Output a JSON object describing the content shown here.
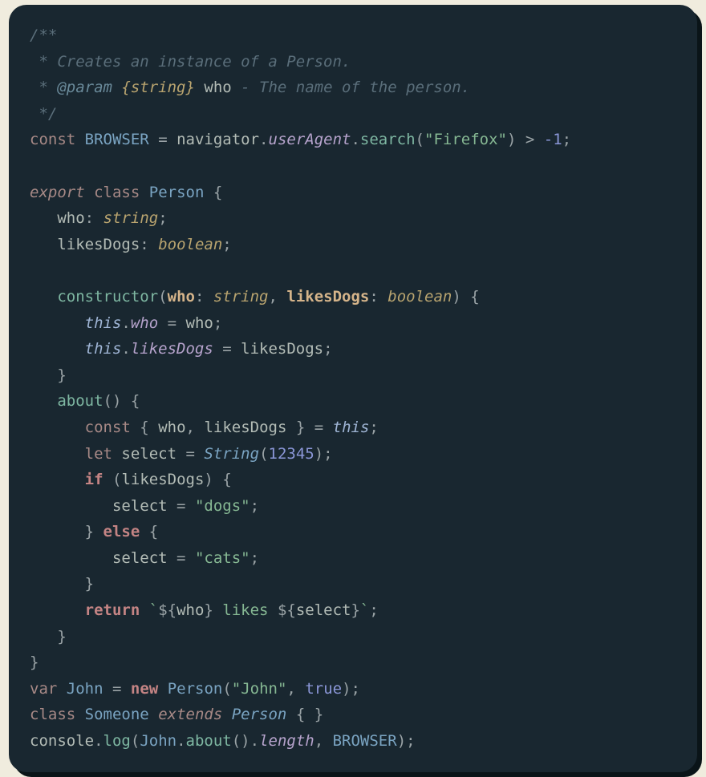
{
  "comment": {
    "open": "/**",
    "line1": " * Creates an instance of a Person.",
    "param_tag": "@param",
    "param_type": "{string}",
    "param_name": "who",
    "param_desc": "- The name of the person.",
    "close": " */"
  },
  "l4": {
    "const": "const",
    "BROWSER": "BROWSER",
    "eq": "=",
    "navigator": "navigator",
    "userAgent": "userAgent",
    "search": "search",
    "arg": "\"Firefox\"",
    "gt": ">",
    "neg1": "-1"
  },
  "l6": {
    "export": "export",
    "class": "class",
    "Person": "Person",
    "brace": "{"
  },
  "l7": {
    "who": "who",
    "colon": ":",
    "type": "string",
    "semi": ";"
  },
  "l8": {
    "likesDogs": "likesDogs",
    "colon": ":",
    "type": "boolean",
    "semi": ";"
  },
  "l10": {
    "constructor": "constructor",
    "who": "who",
    "tstring": "string",
    "likesDogs": "likesDogs",
    "tbool": "boolean"
  },
  "l11": {
    "this": "this",
    "who": "who",
    "eq": "=",
    "rhs": "who"
  },
  "l12": {
    "this": "this",
    "likesDogs": "likesDogs",
    "eq": "=",
    "rhs": "likesDogs"
  },
  "l14": {
    "about": "about"
  },
  "l15": {
    "const": "const",
    "who": "who",
    "likesDogs": "likesDogs",
    "eq": "=",
    "this": "this"
  },
  "l16": {
    "let": "let",
    "select": "select",
    "eq": "=",
    "String": "String",
    "num": "12345"
  },
  "l17": {
    "if": "if",
    "cond": "likesDogs"
  },
  "l18": {
    "select": "select",
    "eq": "=",
    "val": "\"dogs\""
  },
  "l19": {
    "else": "else"
  },
  "l20": {
    "select": "select",
    "eq": "=",
    "val": "\"cats\""
  },
  "l22": {
    "return": "return",
    "who": "who",
    "likes": " likes ",
    "select": "select"
  },
  "l25": {
    "var": "var",
    "John": "John",
    "eq": "=",
    "new": "new",
    "Person": "Person",
    "arg1": "\"John\"",
    "true": "true"
  },
  "l26": {
    "class": "class",
    "Someone": "Someone",
    "extends": "extends",
    "Person": "Person"
  },
  "l27": {
    "console": "console",
    "log": "log",
    "John": "John",
    "about": "about",
    "length": "length",
    "BROWSER": "BROWSER"
  }
}
